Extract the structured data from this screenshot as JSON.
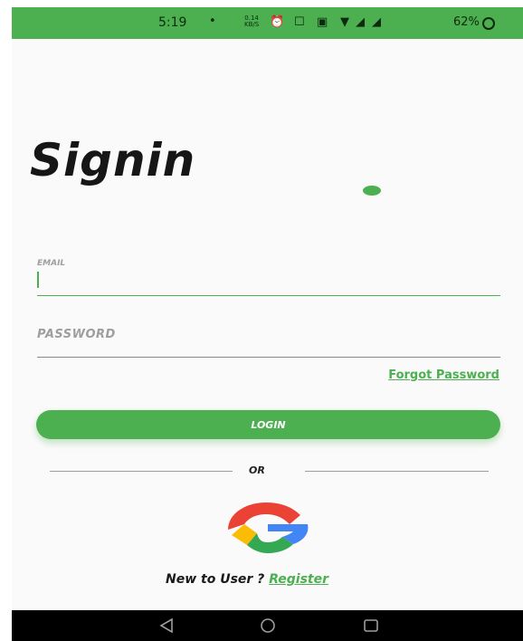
{
  "status_bar": {
    "time": "5:19",
    "dot": "•",
    "net_speed_value": "0.14",
    "net_speed_unit": "KB/S",
    "battery": "62%"
  },
  "screen": {
    "title": "Signin"
  },
  "form": {
    "email_label": "EMAIL",
    "email_value": "",
    "password_label": "PASSWORD",
    "password_value": "",
    "forgot_label": "Forgot Password",
    "login_label": "LOGIN",
    "or_label": "OR"
  },
  "footer": {
    "prompt": "New to User ? ",
    "register_label": "Register"
  },
  "colors": {
    "accent": "#4caf50",
    "background": "#fafafa",
    "title_text": "#161616",
    "nav_bar": "#000000"
  },
  "icons": {
    "google": "google-g-icon",
    "nav_back": "triangle-back-icon",
    "nav_home": "circle-home-icon",
    "nav_recents": "square-recents-icon"
  }
}
